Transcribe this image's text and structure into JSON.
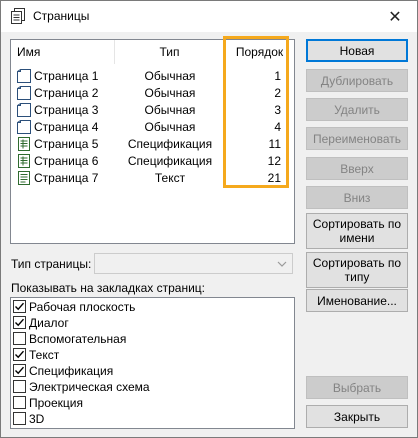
{
  "window": {
    "title": "Страницы",
    "close_glyph": "✕"
  },
  "pages_list": {
    "columns": {
      "name": "Имя",
      "type": "Тип",
      "order": "Порядок"
    },
    "rows": [
      {
        "name": "Страница 1",
        "type": "Обычная",
        "order": "1",
        "icon": "page-icon"
      },
      {
        "name": "Страница 2",
        "type": "Обычная",
        "order": "2",
        "icon": "page-icon"
      },
      {
        "name": "Страница 3",
        "type": "Обычная",
        "order": "3",
        "icon": "page-icon"
      },
      {
        "name": "Страница 4",
        "type": "Обычная",
        "order": "4",
        "icon": "page-icon"
      },
      {
        "name": "Страница 5",
        "type": "Спецификация",
        "order": "11",
        "icon": "spec-page-icon"
      },
      {
        "name": "Страница 6",
        "type": "Спецификация",
        "order": "12",
        "icon": "spec-page-icon"
      },
      {
        "name": "Страница 7",
        "type": "Текст",
        "order": "21",
        "icon": "text-page-icon"
      }
    ]
  },
  "buttons": {
    "new": "Новая",
    "duplicate": "Дублировать",
    "delete": "Удалить",
    "rename": "Переименовать",
    "up": "Вверх",
    "down": "Вниз",
    "sort_by_name": "Сортировать по имени",
    "sort_by_type": "Сортировать по типу",
    "naming": "Именование...",
    "select": "Выбрать",
    "close": "Закрыть"
  },
  "page_type": {
    "label": "Тип страницы:",
    "value": ""
  },
  "show_tabs": {
    "label": "Показывать на закладках страниц:",
    "items": [
      {
        "label": "Рабочая плоскость",
        "checked": true
      },
      {
        "label": "Диалог",
        "checked": true
      },
      {
        "label": "Вспомогательная",
        "checked": false
      },
      {
        "label": "Текст",
        "checked": true
      },
      {
        "label": "Спецификация",
        "checked": true
      },
      {
        "label": "Электрическая схема",
        "checked": false
      },
      {
        "label": "Проекция",
        "checked": false
      },
      {
        "label": "3D",
        "checked": false
      }
    ]
  },
  "colors": {
    "accent": "#0078d7",
    "highlight": "#f5a91d"
  }
}
